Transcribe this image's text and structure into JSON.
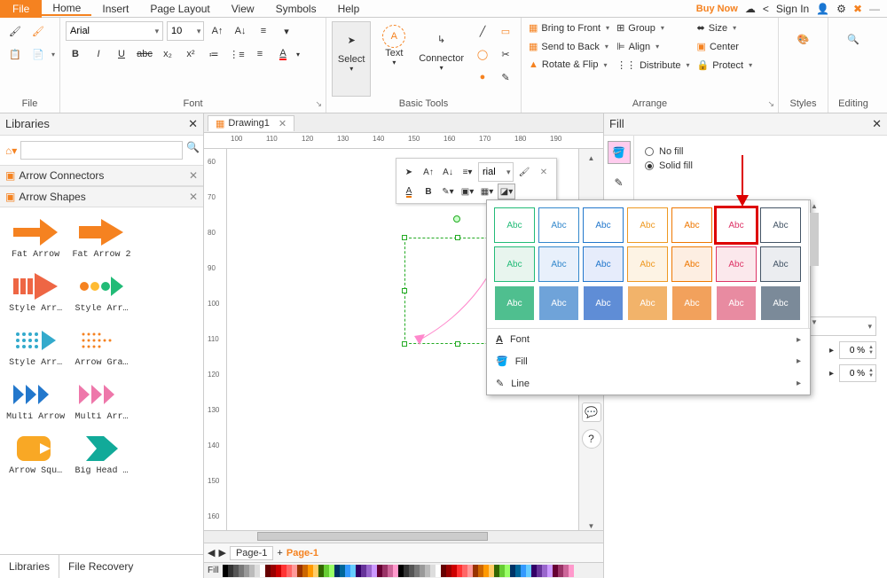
{
  "menu": {
    "file": "File",
    "home": "Home",
    "insert": "Insert",
    "layout": "Page Layout",
    "view": "View",
    "symbols": "Symbols",
    "help": "Help",
    "buy": "Buy Now",
    "signin": "Sign In"
  },
  "ribbon": {
    "file_label": "File",
    "font_label": "Font",
    "basic_label": "Basic Tools",
    "arrange_label": "Arrange",
    "styles_label": "Styles",
    "editing_label": "Editing",
    "font_name": "Arial",
    "font_size": "10",
    "select": "Select",
    "text": "Text",
    "connector": "Connector",
    "bring_front": "Bring to Front",
    "send_back": "Send to Back",
    "rotate_flip": "Rotate & Flip",
    "group": "Group",
    "align": "Align",
    "distribute": "Distribute",
    "size": "Size",
    "center": "Center",
    "protect": "Protect"
  },
  "libraries": {
    "title": "Libraries",
    "cat1": "Arrow Connectors",
    "cat2": "Arrow Shapes",
    "shapes": [
      "Fat Arrow",
      "Fat Arrow 2",
      "",
      "Style Arr…",
      "Style Arr…",
      "",
      "Style Arr…",
      "Arrow Gra…",
      "",
      "Multi Arrow",
      "Multi Arr…",
      "",
      "Arrow Squ…",
      "Big Head …",
      ""
    ],
    "tab1": "Libraries",
    "tab2": "File Recovery"
  },
  "doc": {
    "title": "Drawing1"
  },
  "ruler_h": [
    100,
    110,
    120,
    130,
    140,
    150,
    160,
    170,
    180,
    190
  ],
  "ruler_v": [
    60,
    70,
    80,
    90,
    100,
    110,
    120,
    130,
    140,
    150,
    160
  ],
  "mini": {
    "font": "rial"
  },
  "pages": {
    "p1": "Page-1",
    "p2": "Page-1"
  },
  "fill_bar": "Fill",
  "fill_panel": {
    "title": "Fill",
    "no_fill": "No fill",
    "solid": "Solid fill",
    "val": "0 %"
  },
  "style_popup": {
    "rows": [
      [
        {
          "t": "Abc",
          "c": "#2b7"
        },
        {
          "t": "Abc",
          "c": "#38c"
        },
        {
          "t": "Abc",
          "c": "#27c"
        },
        {
          "t": "Abc",
          "c": "#e92"
        },
        {
          "t": "Abc",
          "c": "#e70"
        },
        {
          "t": "Abc",
          "c": "#d36",
          "hl": true
        },
        {
          "t": "Abc",
          "c": "#456"
        }
      ],
      [
        {
          "t": "Abc",
          "c": "#2b7",
          "bg": "#e8f5ee"
        },
        {
          "t": "Abc",
          "c": "#38c",
          "bg": "#e8f0fb"
        },
        {
          "t": "Abc",
          "c": "#27c",
          "bg": "#e6ecfb"
        },
        {
          "t": "Abc",
          "c": "#e92",
          "bg": "#fdf3e4"
        },
        {
          "t": "Abc",
          "c": "#e70",
          "bg": "#fdeee2"
        },
        {
          "t": "Abc",
          "c": "#d36",
          "bg": "#fbe8ec"
        },
        {
          "t": "Abc",
          "c": "#456",
          "bg": "#ebedf0"
        }
      ],
      [
        {
          "t": "Abc",
          "c": "#fff",
          "bg": "#4fbf8f"
        },
        {
          "t": "Abc",
          "c": "#fff",
          "bg": "#6fa3d9"
        },
        {
          "t": "Abc",
          "c": "#fff",
          "bg": "#5f8dd6"
        },
        {
          "t": "Abc",
          "c": "#fff",
          "bg": "#f2b36a"
        },
        {
          "t": "Abc",
          "c": "#fff",
          "bg": "#f2a15c"
        },
        {
          "t": "Abc",
          "c": "#fff",
          "bg": "#e88ba1"
        },
        {
          "t": "Abc",
          "c": "#fff",
          "bg": "#7b8a99"
        }
      ]
    ],
    "font": "Font",
    "fill": "Fill",
    "line": "Line"
  }
}
